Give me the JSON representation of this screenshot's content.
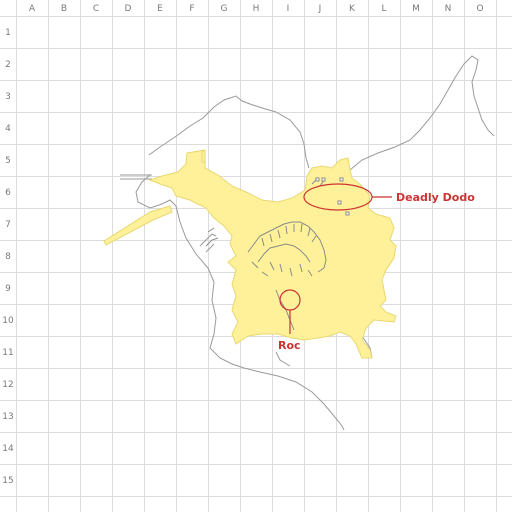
{
  "grid": {
    "columns": [
      "A",
      "B",
      "C",
      "D",
      "E",
      "F",
      "G",
      "H",
      "I",
      "J",
      "K",
      "L",
      "M",
      "N",
      "O"
    ],
    "rows": [
      "1",
      "2",
      "3",
      "4",
      "5",
      "6",
      "7",
      "8",
      "9",
      "10",
      "11",
      "12",
      "13",
      "14",
      "15"
    ]
  },
  "markers": {
    "deadly_dodo": {
      "label": "Deadly Dodo"
    },
    "roc": {
      "label": "Roc"
    }
  },
  "colors": {
    "grid_line": "#dcdcdc",
    "land_fill": "#fff19a",
    "land_edge": "#e8d870",
    "outline": "#9a9a9a",
    "marker": "#cc3333"
  }
}
